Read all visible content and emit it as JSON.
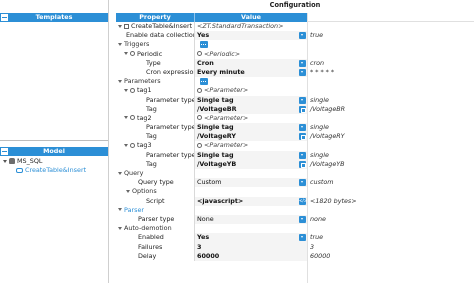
{
  "left": {
    "templates_title": "Templates",
    "model_title": "Model",
    "model_root": "MS_SQL",
    "model_child": "CreateTable&Insert"
  },
  "config": {
    "title": "Configuration",
    "col_property": "Property",
    "col_value": "Value"
  },
  "rows": [
    {
      "label": "CreateTable&Insert",
      "value": "<ZT.StandardTransaction>",
      "ext": ""
    },
    {
      "label": "Enable data collection",
      "value": "Yes",
      "ext": "true"
    },
    {
      "label": "Triggers",
      "value": "",
      "ext": ""
    },
    {
      "label": "Periodic",
      "value": "<Periodic>",
      "ext": ""
    },
    {
      "label": "Type",
      "value": "Cron",
      "ext": "cron"
    },
    {
      "label": "Cron expression",
      "value": "Every minute",
      "ext": "* * * * *"
    },
    {
      "label": "Parameters",
      "value": "",
      "ext": ""
    },
    {
      "label": "tag1",
      "value": "<Parameter>",
      "ext": ""
    },
    {
      "label": "Parameter type",
      "value": "Single tag",
      "ext": "single"
    },
    {
      "label": "Tag",
      "value": "/VoltageBR",
      "ext": "/VoltageBR"
    },
    {
      "label": "tag2",
      "value": "<Parameter>",
      "ext": ""
    },
    {
      "label": "Parameter type",
      "value": "Single tag",
      "ext": "single"
    },
    {
      "label": "Tag",
      "value": "/VoltageRY",
      "ext": "/VoltageRY"
    },
    {
      "label": "tag3",
      "value": "<Parameter>",
      "ext": ""
    },
    {
      "label": "Parameter type",
      "value": "Single tag",
      "ext": "single"
    },
    {
      "label": "Tag",
      "value": "/VoltageYB",
      "ext": "/VoltageYB"
    },
    {
      "label": "Query",
      "value": "",
      "ext": ""
    },
    {
      "label": "Query type",
      "value": "Custom",
      "ext": "custom"
    },
    {
      "label": "Options",
      "value": "",
      "ext": ""
    },
    {
      "label": "Script",
      "value": "<javascript>",
      "ext": "<1820 bytes>"
    },
    {
      "label": "Parser",
      "value": "",
      "ext": ""
    },
    {
      "label": "Parser type",
      "value": "None",
      "ext": "none"
    },
    {
      "label": "Auto-demotion",
      "value": "",
      "ext": ""
    },
    {
      "label": "Enabled",
      "value": "Yes",
      "ext": "true"
    },
    {
      "label": "Failures",
      "value": "3",
      "ext": "3"
    },
    {
      "label": "Delay",
      "value": "60000",
      "ext": "60000"
    }
  ],
  "colors": {
    "accent": "#2c8fd6",
    "link": "#2c8fd6"
  }
}
